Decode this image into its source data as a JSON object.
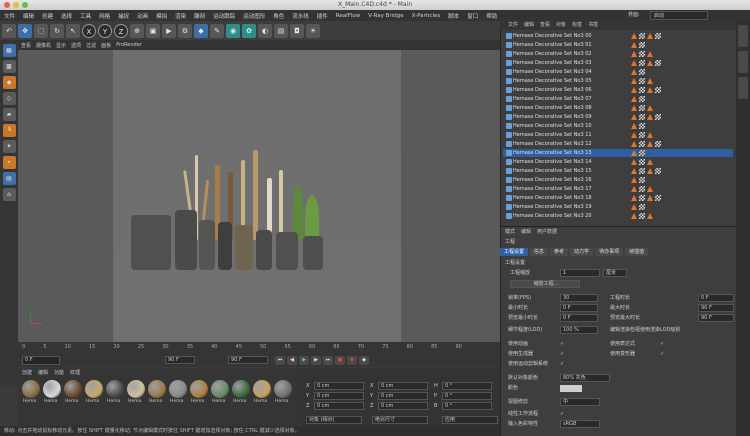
{
  "window": {
    "title": "X_Main.C4D.c4d * - Main",
    "layout_label": "界面:",
    "layout_value": "启动"
  },
  "menu": [
    "文件",
    "编辑",
    "创建",
    "选择",
    "工具",
    "网格",
    "捕捉",
    "动画",
    "模拟",
    "渲染",
    "雕刻",
    "运动跟踪",
    "运动图形",
    "角色",
    "流水线",
    "插件",
    "RealFlow",
    "V-Ray Bridge",
    "X-Particles",
    "脚本",
    "窗口",
    "帮助"
  ],
  "toolbar_icons": [
    "undo-icon",
    "move-icon",
    "rotate-icon",
    "scale-icon",
    "x-axis-icon",
    "y-axis-icon",
    "z-axis-icon",
    "world-icon",
    "render-view-icon",
    "render-icon",
    "render-settings-icon",
    "cube-icon",
    "pen-icon",
    "subdiv-icon",
    "cloner-icon",
    "deformer-icon",
    "floor-icon",
    "camera-icon",
    "light-icon"
  ],
  "toolbar_letters": {
    "x": "X",
    "y": "Y",
    "z": "Z"
  },
  "viewport": {
    "menu": [
      "查看",
      "摄像机",
      "显示",
      "选项",
      "过滤",
      "面板",
      "ProRender"
    ]
  },
  "timeline": {
    "ticks": [
      "0",
      "5",
      "10",
      "15",
      "20",
      "25",
      "30",
      "35",
      "40",
      "45",
      "50",
      "55",
      "60",
      "65",
      "70",
      "75",
      "80",
      "85",
      "90"
    ],
    "current": "0 F",
    "start": "0 F",
    "end": "90 F",
    "end2": "90 F"
  },
  "materials": {
    "menu": [
      "创建",
      "编辑",
      "功能",
      "纹理"
    ],
    "items": [
      "Hema",
      "Hema",
      "Hema",
      "Hema",
      "Hema",
      "Hema",
      "Hema",
      "Hema",
      "Hema",
      "Hema",
      "Hema",
      "Hema",
      "Hema"
    ]
  },
  "coords": {
    "rows": [
      [
        "X",
        "0 cm",
        "X",
        "0 cm",
        "H",
        "0 °"
      ],
      [
        "Y",
        "0 cm",
        "Y",
        "0 cm",
        "P",
        "0 °"
      ],
      [
        "Z",
        "0 cm",
        "Z",
        "0 cm",
        "B",
        "0 °"
      ]
    ],
    "mode": "对象 (相对)",
    "size": "绝对尺寸",
    "apply": "应用"
  },
  "status": "移动: 点击并拖动鼠标移动元素。按住 SHIFT 键量化移动; 节点编辑模式时按住 SHIFT 键增加选择对象; 按住 CTRL 键减少选择对象。",
  "objects": {
    "tabs": [
      "文件",
      "编辑",
      "查看",
      "对象",
      "标签",
      "书签"
    ],
    "items": [
      "Hemase Decorative Set No3 00",
      "Hemase Decorative Set No3 01",
      "Hemase Decorative Set No3 02",
      "Hemase Decorative Set No3 03",
      "Hemase Decorative Set No3 04",
      "Hemase Decorative Set No3 05",
      "Hemase Decorative Set No3 06",
      "Hemase Decorative Set No3 07",
      "Hemase Decorative Set No3 08",
      "Hemase Decorative Set No3 09",
      "Hemase Decorative Set No3 10",
      "Hemase Decorative Set No3 11",
      "Hemase Decorative Set No3 12",
      "Hemase Decorative Set No3 13",
      "Hemase Decorative Set No3 14",
      "Hemase Decorative Set No3 15",
      "Hemase Decorative Set No3 16",
      "Hemase Decorative Set No3 17",
      "Hemase Decorative Set No3 18",
      "Hemase Decorative Set No3 19",
      "Hemase Decorative Set No3 20"
    ]
  },
  "attributes": {
    "menu": [
      "模式",
      "编辑",
      "用户数据"
    ],
    "title": "工程",
    "tabs": [
      "工程设置",
      "信息",
      "参考",
      "动力学",
      "待办事项",
      "帧插值"
    ],
    "section": "工程设置",
    "scale_label": "工程缩放",
    "scale_value": "1",
    "scale_unit": "厘米",
    "scale_btn": "缩放工程...",
    "fps_label": "帧率(FPS)",
    "fps_value": "30",
    "duration_label": "工程时长",
    "duration_value": "0 F",
    "min_label": "最小时长",
    "min_value": "0 F",
    "max_label": "最大时长",
    "max_value": "90 F",
    "pmin_label": "预览最小时长",
    "pmin_value": "0 F",
    "pmax_label": "预览最大时长",
    "pmax_value": "90 F",
    "lod_label": "细节程度(LOD)",
    "lod_value": "100 %",
    "lod_render_label": "编辑渲染检视使用渲染LOD级别",
    "anim_label": "使用动画",
    "expr_label": "使用表达式",
    "gen_label": "使用生成器",
    "deform_label": "使用变形器",
    "motion_label": "使用运动剪辑系统",
    "color_label": "默认对象颜色",
    "color_value": "80% 灰色",
    "color2_label": "颜色",
    "clip_label": "视图修剪",
    "clip_value": "中",
    "linear_label": "线性工作流程",
    "input_label": "输入色彩特性",
    "input_value": "sRGB"
  }
}
